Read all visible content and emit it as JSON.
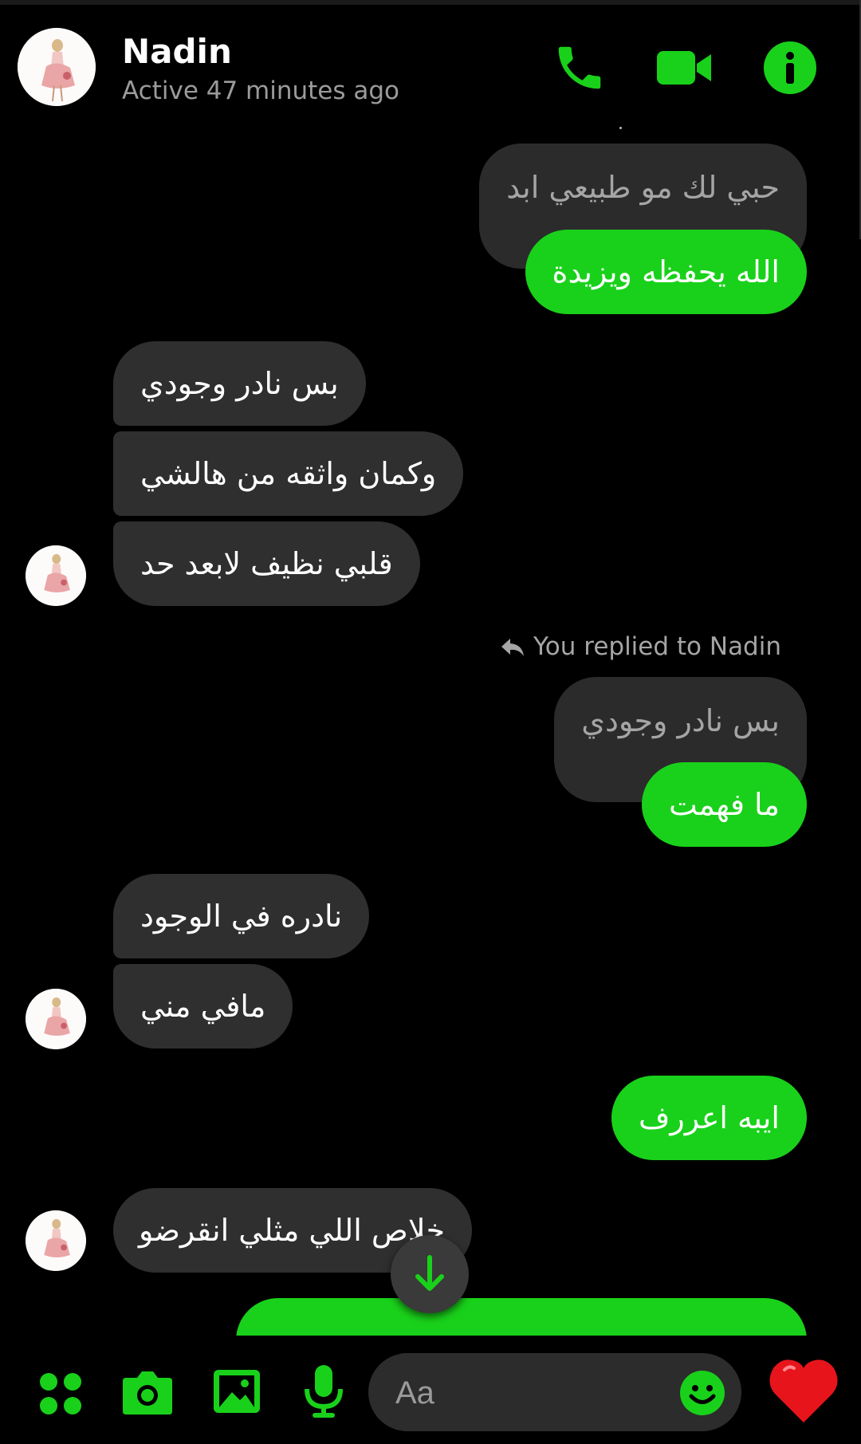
{
  "header": {
    "name": "Nadin",
    "status": "Active 47 minutes ago"
  },
  "messages": [
    {
      "side": "out-quote",
      "text": "حبي لك مو طبيعي ابد"
    },
    {
      "side": "out",
      "text": "الله يحفظه ويزيدة"
    },
    {
      "side": "in",
      "text": "بس نادر وجودي"
    },
    {
      "side": "in",
      "text": "وكمان واثقه من هالشي"
    },
    {
      "side": "in",
      "text": "قلبي نظيف لابعد حد"
    },
    {
      "side": "out-quote",
      "text": "بس نادر وجودي"
    },
    {
      "side": "out",
      "text": "ما فهمت"
    },
    {
      "side": "in",
      "text": "نادره في الوجود"
    },
    {
      "side": "in",
      "text": "مافي مني"
    },
    {
      "side": "out",
      "text": "ايبه اعررف"
    },
    {
      "side": "in",
      "text": "خلاص اللي مثلي انقرضو"
    }
  ],
  "reply_note": "You replied to Nadin",
  "composer": {
    "placeholder": "Aa"
  },
  "colors": {
    "accent": "#19d11a",
    "incoming_bubble": "#2f2f2f",
    "background": "#000000"
  },
  "icons": [
    "phone-icon",
    "video-icon",
    "info-icon",
    "reply-icon",
    "arrow-down-icon",
    "apps-icon",
    "camera-icon",
    "gallery-icon",
    "microphone-icon",
    "emoji-icon",
    "heart-icon"
  ]
}
